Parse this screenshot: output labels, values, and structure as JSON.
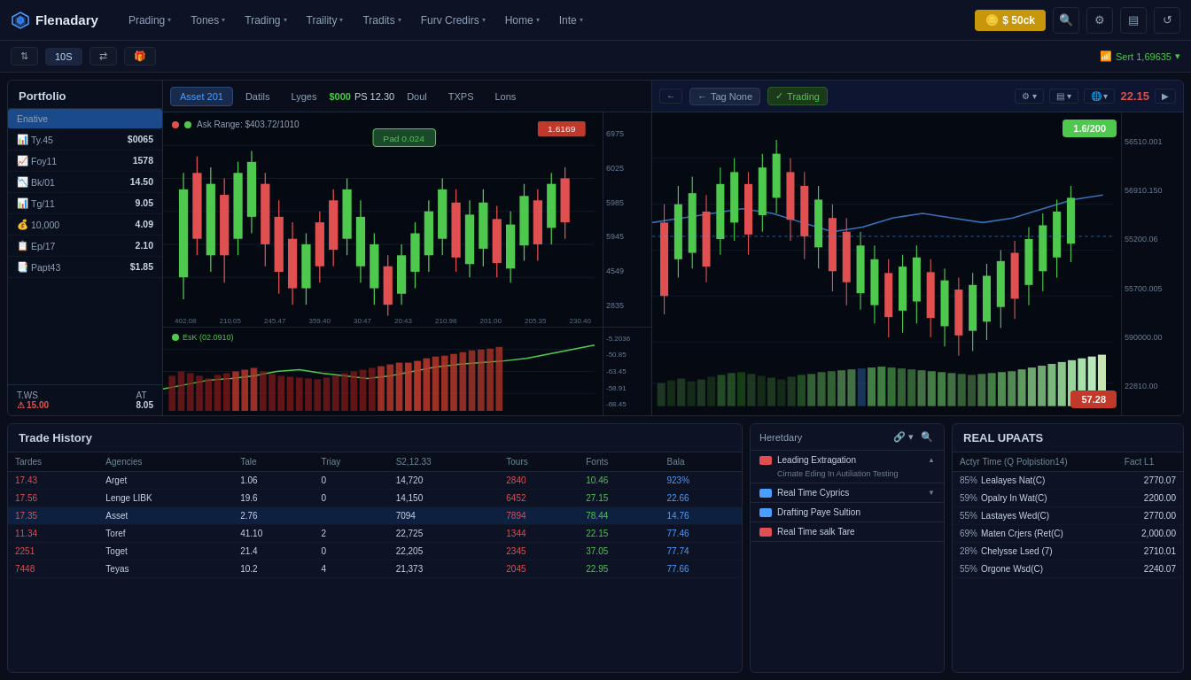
{
  "app": {
    "name": "Flenadary",
    "logo_alt": "Flenadary Logo"
  },
  "topnav": {
    "balance_label": "$ 50ck",
    "nav_items": [
      {
        "label": "Prading",
        "has_arrow": true
      },
      {
        "label": "Tones",
        "has_arrow": true
      },
      {
        "label": "Trading",
        "has_arrow": true
      },
      {
        "label": "Traility",
        "has_arrow": true
      },
      {
        "label": "Tradits",
        "has_arrow": true
      },
      {
        "label": "Furv Credirs",
        "has_arrow": true
      },
      {
        "label": "Home",
        "has_arrow": true
      },
      {
        "label": "Inte",
        "has_arrow": true
      }
    ],
    "icon_btns": [
      "⇄",
      "≡",
      "⚙",
      "♻"
    ]
  },
  "secondnav": {
    "buttons": [
      "⇅",
      "10S",
      "⇄",
      "🎁"
    ],
    "sert_label": "Sert 1,69635",
    "sert_arrow": "▼"
  },
  "portfolio": {
    "title": "Portfolio",
    "active_item": "Enative",
    "items": [
      {
        "icon": "📊",
        "label": "Ty.45",
        "value": "$0065"
      },
      {
        "icon": "📈",
        "label": "Foy11",
        "value": "1578"
      },
      {
        "icon": "📉",
        "label": "Bk/01",
        "value": "14.50"
      },
      {
        "icon": "📊",
        "label": "Tg/11",
        "value": "9.05"
      },
      {
        "icon": "💰",
        "label": "10,000",
        "value": "4.09"
      },
      {
        "icon": "📋",
        "label": "Ep/17",
        "value": "2.10"
      },
      {
        "icon": "📑",
        "label": "Papt43",
        "value": "$1.85"
      }
    ],
    "footer": {
      "label1": "T.WS",
      "label2": "AT",
      "val1": "15.00",
      "val2": "8.05"
    }
  },
  "chart": {
    "tabs": [
      "Asset 201",
      "Datils",
      "Lyges",
      "$000",
      "PS 12.30",
      "Doul",
      "TXPS",
      "Lons"
    ],
    "active_tab": "Asset 201",
    "ask_range": "Ask Range: $403.72/1010",
    "popup_label": "Pad 0.024",
    "price_tag": "1.6169",
    "times": [
      "402.08",
      "210.05",
      "245.47",
      "359.40",
      "30:47",
      "20:43",
      "210.98",
      "201.00",
      "205.35",
      "230.40"
    ],
    "price_levels": [
      "6975",
      "6025",
      "5985",
      "5945",
      "4549",
      "2835"
    ],
    "oscillator": {
      "label": "EsK (02.0910)",
      "price_levels": [
        "-5.2036",
        "-50.85",
        "-63.45",
        "-58.91",
        "-68.45"
      ]
    }
  },
  "right_chart": {
    "tag_none": "Tag None",
    "trading_label": "Trading",
    "tools": [
      "⚙",
      "▤",
      "🌐"
    ],
    "price": "22.15",
    "price_levels": [
      "56510.001",
      "56910.150",
      "55200.06",
      "55700.005",
      "590000.00",
      "22810.00"
    ],
    "bid_label": "1.6/200",
    "buy_label": "57.28"
  },
  "trade_history": {
    "title": "Trade History",
    "columns": [
      "Tardes",
      "Agencies",
      "Tale",
      "Triay",
      "S2,12.33",
      "Tours",
      "Fonts",
      "Bala"
    ],
    "rows": [
      {
        "id": "17.43",
        "agency": "Arget",
        "tale": "1.06",
        "triay": "0",
        "s2": "14,720",
        "tours": "2840",
        "fonts": "10.46",
        "bala": "923%",
        "highlight": false
      },
      {
        "id": "17.56",
        "agency": "Lenge LIBK",
        "tale": "19.6",
        "triay": "0",
        "s2": "14,150",
        "tours": "6452",
        "fonts": "27.15",
        "bala": "22.66",
        "highlight": false
      },
      {
        "id": "17.35",
        "agency": "Asset",
        "tale": "2.76",
        "triay": "",
        "s2": "7094",
        "tours": "7894",
        "fonts": "78.44",
        "bala": "14.76",
        "highlight": true
      },
      {
        "id": "11.34",
        "agency": "Toref",
        "tale": "41.10",
        "triay": "2",
        "s2": "22,725",
        "tours": "1344",
        "fonts": "22.15",
        "bala": "77.46",
        "highlight": false
      },
      {
        "id": "2251",
        "agency": "Toget",
        "tale": "21.4",
        "triay": "0",
        "s2": "22,205",
        "tours": "2345",
        "fonts": "37.05",
        "bala": "77.74",
        "highlight": false
      },
      {
        "id": "7448",
        "agency": "Teyas",
        "tale": "10.2",
        "triay": "4",
        "s2": "21,373",
        "tours": "2045",
        "fonts": "22.95",
        "bala": "77.66",
        "highlight": false
      }
    ]
  },
  "market_data": {
    "title": "Heretdary",
    "groups": [
      {
        "flag": "red",
        "title": "Leading Extragation",
        "desc": "Cirnate Eding In Autiliation Testing",
        "expanded": true
      },
      {
        "flag": "blue",
        "title": "Real Time Cyprics",
        "desc": "",
        "expanded": false
      },
      {
        "flag": "blue",
        "title": "Drafting Paye Sultion",
        "desc": "",
        "expanded": false
      },
      {
        "flag": "red",
        "title": "Real Time salk Tare",
        "desc": "",
        "expanded": false
      }
    ]
  },
  "real_updates": {
    "title": "REAL UPAATS",
    "header_label": "Actyr Time (Q Polpistion14)",
    "columns": [
      "Actyr Time (Q Polpistion14)",
      "Fact L1"
    ],
    "rows": [
      {
        "label": "Lealayes Nat(C)",
        "pct": "85%",
        "value": "2770.07"
      },
      {
        "label": "Opalry In Wat(C)",
        "pct": "59%",
        "value": "2200.00"
      },
      {
        "label": "Lastayes Wed(C)",
        "pct": "55%",
        "value": "2770.00"
      },
      {
        "label": "Maten Crjers (Ret(C)",
        "pct": "69%",
        "value": "2,000.00"
      },
      {
        "label": "Chelysse Lsed (7)",
        "pct": "28%",
        "value": "2710.01"
      },
      {
        "label": "Orgone Wsd(C)",
        "pct": "55%",
        "value": "2240.07"
      }
    ]
  },
  "colors": {
    "green": "#4ec94e",
    "red": "#e05050",
    "blue": "#4a9eff",
    "accent": "#c8960a",
    "bg_dark": "#0a0e1a",
    "bg_panel": "#0d1224",
    "border": "#1e2a3a"
  }
}
